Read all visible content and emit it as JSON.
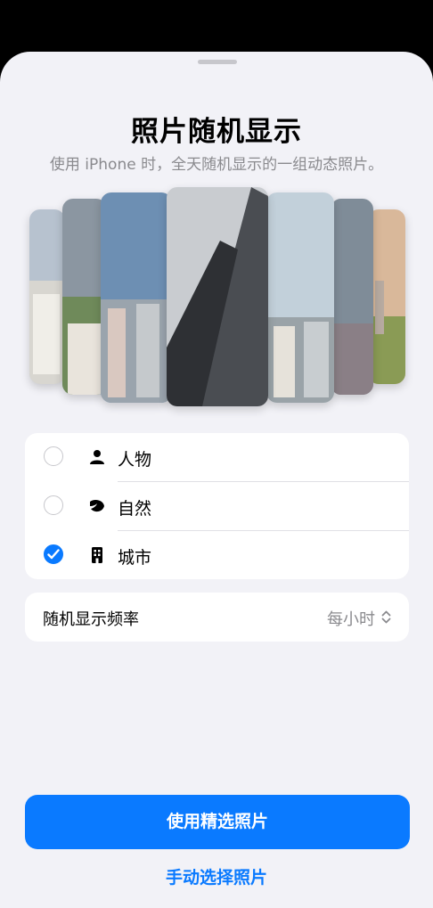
{
  "sheet": {
    "title": "照片随机显示",
    "subtitle": "使用 iPhone 时，全天随机显示的一组动态照片。"
  },
  "categories": [
    {
      "label": "人物",
      "icon": "person-icon",
      "selected": false
    },
    {
      "label": "自然",
      "icon": "leaf-icon",
      "selected": false
    },
    {
      "label": "城市",
      "icon": "building-icon",
      "selected": true
    }
  ],
  "frequency": {
    "label": "随机显示频率",
    "value": "每小时"
  },
  "actions": {
    "primary_label": "使用精选照片",
    "secondary_label": "手动选择照片"
  },
  "colors": {
    "accent": "#0a7aff",
    "background": "#f2f2f7"
  }
}
